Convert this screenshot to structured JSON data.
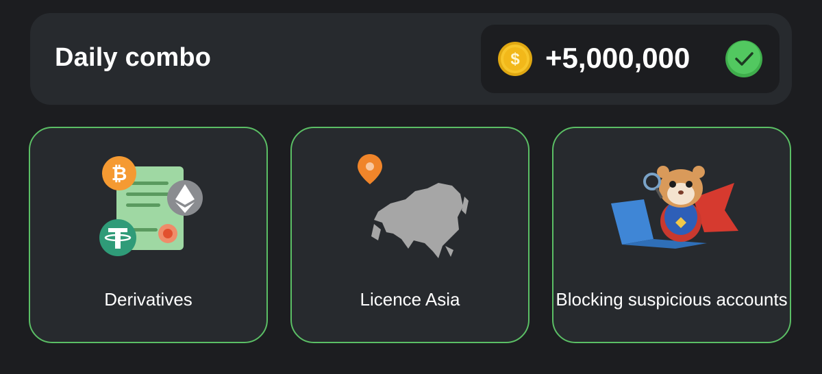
{
  "header": {
    "title": "Daily combo",
    "reward_amount": "+5,000,000",
    "coin_icon": "dollar-coin-icon",
    "status_icon": "green-check-icon"
  },
  "cards": [
    {
      "label": "Derivatives",
      "icon": "crypto-document-illustration"
    },
    {
      "label": "Licence Asia",
      "icon": "asia-map-pin-illustration"
    },
    {
      "label": "Blocking suspicious accounts",
      "icon": "hamster-detective-laptop-illustration"
    }
  ],
  "colors": {
    "background": "#1c1d20",
    "panel": "#272a2e",
    "card_border": "#5bbf65",
    "coin": "#f5c21b",
    "check": "#4cc35a"
  }
}
